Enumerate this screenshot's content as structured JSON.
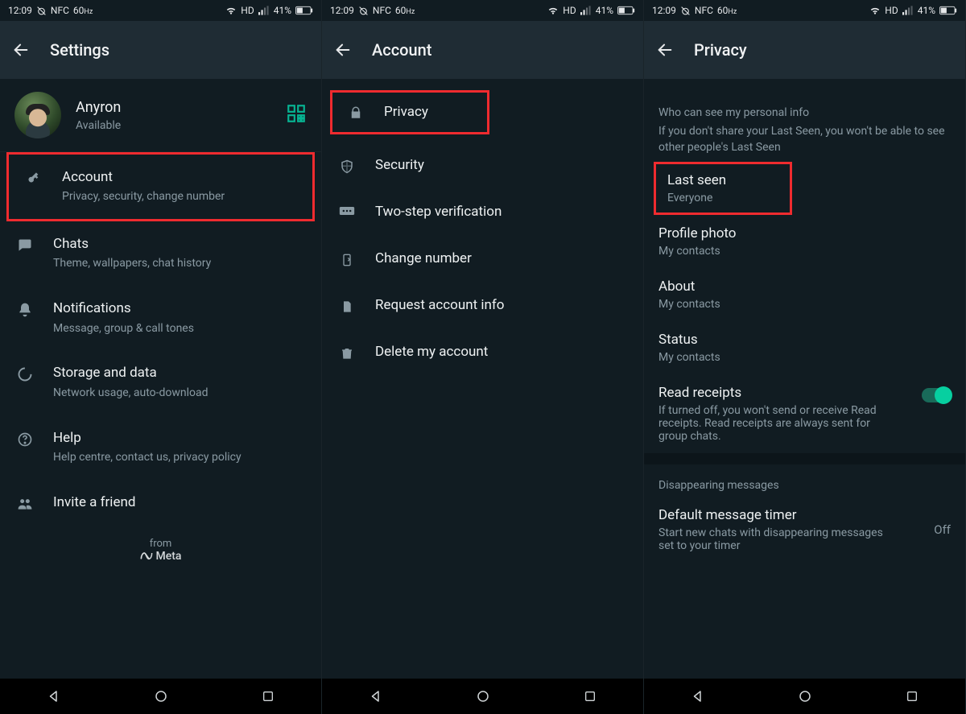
{
  "status": {
    "time": "12:09",
    "nfc": "NFC",
    "refresh": "60",
    "hz_suffix": "Hz",
    "hd": "HD",
    "battery": "41%"
  },
  "screen1": {
    "title": "Settings",
    "profile": {
      "name": "Anyron",
      "sub": "Available"
    },
    "items": [
      {
        "title": "Account",
        "sub": "Privacy, security, change number"
      },
      {
        "title": "Chats",
        "sub": "Theme, wallpapers, chat history"
      },
      {
        "title": "Notifications",
        "sub": "Message, group & call tones"
      },
      {
        "title": "Storage and data",
        "sub": "Network usage, auto-download"
      },
      {
        "title": "Help",
        "sub": "Help centre, contact us, privacy policy"
      },
      {
        "title": "Invite a friend",
        "sub": ""
      }
    ],
    "from": "from",
    "meta": "Meta"
  },
  "screen2": {
    "title": "Account",
    "items": [
      {
        "title": "Privacy"
      },
      {
        "title": "Security"
      },
      {
        "title": "Two-step verification"
      },
      {
        "title": "Change number"
      },
      {
        "title": "Request account info"
      },
      {
        "title": "Delete my account"
      }
    ]
  },
  "screen3": {
    "title": "Privacy",
    "section1_header": "Who can see my personal info",
    "section1_desc": "If you don't share your Last Seen, you won't be able to see other people's Last Seen",
    "items": [
      {
        "title": "Last seen",
        "sub": "Everyone"
      },
      {
        "title": "Profile photo",
        "sub": "My contacts"
      },
      {
        "title": "About",
        "sub": "My contacts"
      },
      {
        "title": "Status",
        "sub": "My contacts"
      }
    ],
    "read_receipts": {
      "title": "Read receipts",
      "sub": "If turned off, you won't send or receive Read receipts. Read receipts are always sent for group chats."
    },
    "disappearing_header": "Disappearing messages",
    "timer": {
      "title": "Default message timer",
      "sub": "Start new chats with disappearing messages set to your timer",
      "value": "Off"
    }
  }
}
